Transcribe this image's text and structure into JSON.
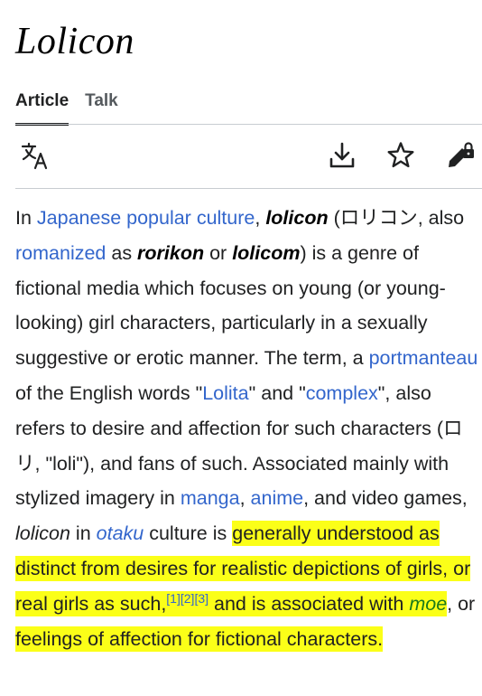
{
  "page": {
    "title": "Lolicon"
  },
  "tabs": [
    {
      "label": "Article",
      "active": true
    },
    {
      "label": "Talk",
      "active": false
    }
  ],
  "toolbar": {
    "language_icon": "translate-icon",
    "download_icon": "download-icon",
    "watch_icon": "star-icon",
    "edit_icon": "edit-locked-icon"
  },
  "article": {
    "s1": "In ",
    "l_japanese": "Japanese popular culture",
    "s2": ", ",
    "b_lolicon": "lolicon",
    "s3": " (ロリコン, also ",
    "l_romanized": "romanized",
    "s4": " as ",
    "b_rorikon": "rorikon",
    "s5": " or ",
    "b_lolicom": "lolicom",
    "s6": ") is a genre of fictional media which focuses on young (or young-looking) girl characters, particularly in a sexually suggestive or erotic manner. The term, a ",
    "l_portmanteau": "portmanteau",
    "s7": " of the English words \"",
    "l_lolita": "Lolita",
    "s8": "\" and \"",
    "l_complex": "complex",
    "s9": "\", also refers to desire and affection for such characters (ロリ, \"loli\"), and fans of such. Associated mainly with stylized imagery in ",
    "l_manga": "manga",
    "s10": ", ",
    "l_anime": "anime",
    "s11": ", and video games, ",
    "i_lolicon": "lolicon",
    "s12": " in ",
    "l_otaku": "otaku",
    "s13": " culture is ",
    "h1": "generally understood as distinct from desires for realistic depictions of girls, or real girls as such,",
    "c1": "[1]",
    "c2": "[2]",
    "c3": "[3]",
    "h2": " and is associated with ",
    "l_moe": "moe",
    "s14": ", or ",
    "h3": "feelings of affection for fictional characters."
  },
  "colors": {
    "link": "#3366cc",
    "highlight": "#fbff18",
    "text": "#202122"
  }
}
